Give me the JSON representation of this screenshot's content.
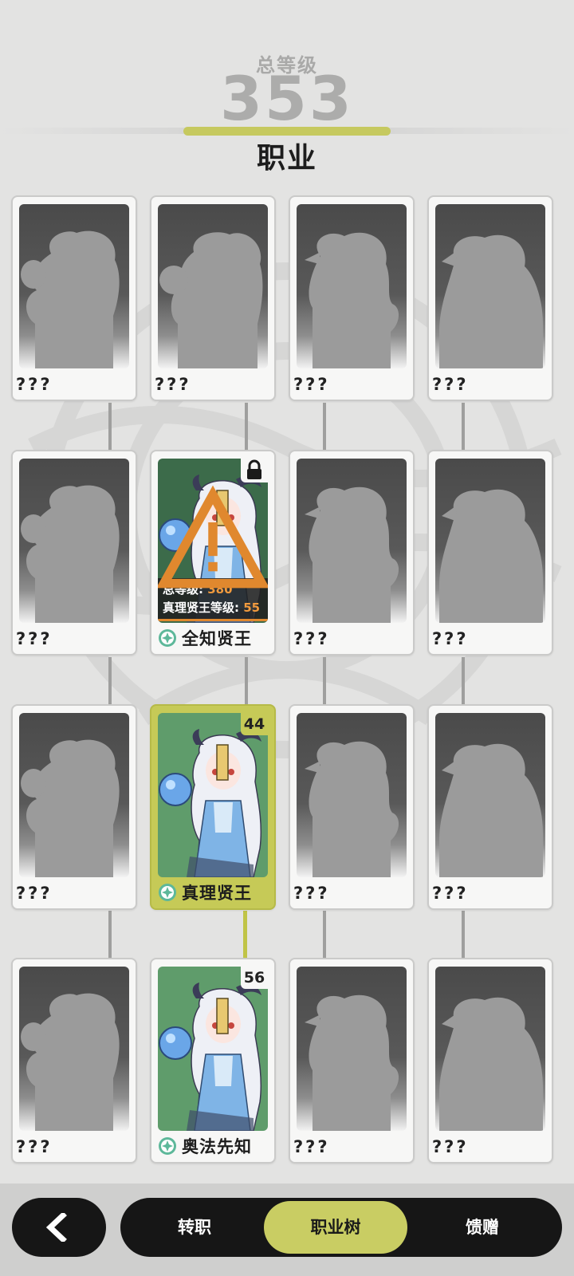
{
  "header": {
    "total_label": "总等级",
    "total_value": "353",
    "title": "职业"
  },
  "cards": {
    "locked_name": "???",
    "omniscient": {
      "name": "全知贤王",
      "req_total_label": "总等级: ",
      "req_total_value": "380",
      "req_class_label": "真理贤王等级: ",
      "req_class_value": "55"
    },
    "truth": {
      "name": "真理贤王",
      "level": "44"
    },
    "arcane": {
      "name": "奥法先知",
      "level": "56"
    }
  },
  "tabs": {
    "transfer": "转职",
    "tree": "职业树",
    "gift": "馈赠"
  },
  "colors": {
    "accent": "#c6ca57",
    "warning": "#e0882e",
    "dark": "#161616"
  },
  "icons": {
    "back": "chevron-left-icon",
    "lock": "lock-icon",
    "warning": "warning-triangle-icon",
    "class": "class-emblem-icon"
  }
}
